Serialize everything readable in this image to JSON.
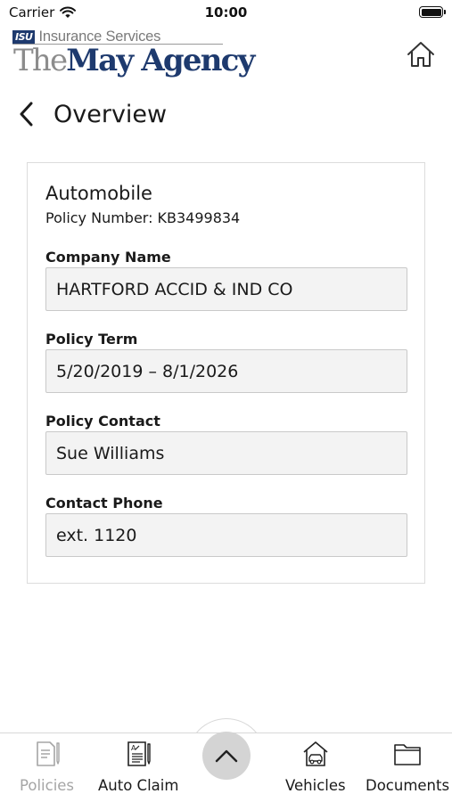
{
  "status_bar": {
    "carrier": "Carrier",
    "time": "10:00"
  },
  "header": {
    "logo_badge": "ISU",
    "logo_services": "Insurance Services",
    "logo_the": "The",
    "logo_agency": "May Agency",
    "home_icon": "home-icon"
  },
  "page": {
    "title": "Overview",
    "back_icon": "chevron-left-icon"
  },
  "policy": {
    "type": "Automobile",
    "number_label": "Policy Number:",
    "number": "KB3499834",
    "fields": [
      {
        "label": "Company Name",
        "value": "HARTFORD ACCID & IND CO"
      },
      {
        "label": "Policy Term",
        "value": "5/20/2019 – 8/1/2026"
      },
      {
        "label": "Policy Contact",
        "value": "Sue Williams"
      },
      {
        "label": "Contact Phone",
        "value": "ext. 1120"
      }
    ]
  },
  "tabs": [
    {
      "label": "Policies",
      "icon": "policies-icon",
      "active": false
    },
    {
      "label": "Auto Claim",
      "icon": "auto-claim-icon",
      "active": true
    },
    {
      "label": "Vehicles",
      "icon": "vehicles-icon",
      "active": true
    },
    {
      "label": "Documents",
      "icon": "folder-icon",
      "active": true
    }
  ],
  "center_button": {
    "icon": "chevron-up-icon"
  },
  "colors": {
    "brand_navy": "#1e3a6e",
    "logo_gray": "#8c8c8c",
    "inactive_tab": "#a5a5a5",
    "field_bg": "#f3f3f3"
  }
}
